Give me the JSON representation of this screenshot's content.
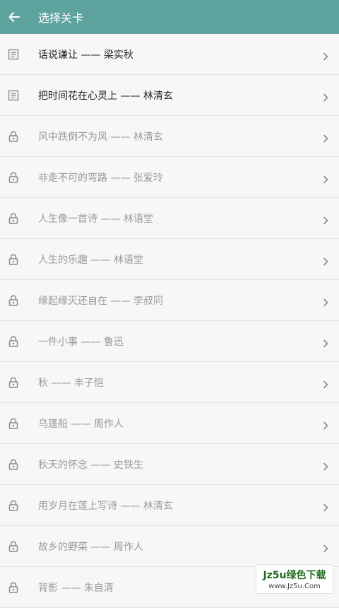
{
  "header": {
    "title": "选择关卡",
    "back_icon": "arrow-left-icon"
  },
  "items": [
    {
      "label": "话说谦让 —— 梁实秋",
      "state": "open",
      "icon": "document-icon"
    },
    {
      "label": "把时间花在心灵上 —— 林清玄",
      "state": "open",
      "icon": "document-icon"
    },
    {
      "label": "风中跌倒不为风 —— 林清玄",
      "state": "locked",
      "icon": "lock-icon"
    },
    {
      "label": "非走不可的弯路 —— 张爱玲",
      "state": "locked",
      "icon": "lock-icon"
    },
    {
      "label": "人生像一首诗 —— 林语堂",
      "state": "locked",
      "icon": "lock-icon"
    },
    {
      "label": "人生的乐趣 —— 林语堂",
      "state": "locked",
      "icon": "lock-icon"
    },
    {
      "label": "缘起缘灭还自在 —— 李叔同",
      "state": "locked",
      "icon": "lock-icon"
    },
    {
      "label": "一件小事 —— 鲁迅",
      "state": "locked",
      "icon": "lock-icon"
    },
    {
      "label": "秋 —— 丰子恺",
      "state": "locked",
      "icon": "lock-icon"
    },
    {
      "label": "乌篷船 —— 周作人",
      "state": "locked",
      "icon": "lock-icon"
    },
    {
      "label": "秋天的怀念 —— 史铁生",
      "state": "locked",
      "icon": "lock-icon"
    },
    {
      "label": "用岁月在莲上写诗 —— 林清玄",
      "state": "locked",
      "icon": "lock-icon"
    },
    {
      "label": "故乡的野菜 —— 周作人",
      "state": "locked",
      "icon": "lock-icon"
    },
    {
      "label": "背影 —— 朱自清",
      "state": "locked",
      "icon": "lock-icon"
    }
  ],
  "watermark": {
    "line1": "Jz5u绿色下载",
    "line2": "www.Jz5u.Com"
  },
  "colors": {
    "appbar": "#5fa39f",
    "text_open": "#222222",
    "text_locked": "#9a9a9a"
  }
}
